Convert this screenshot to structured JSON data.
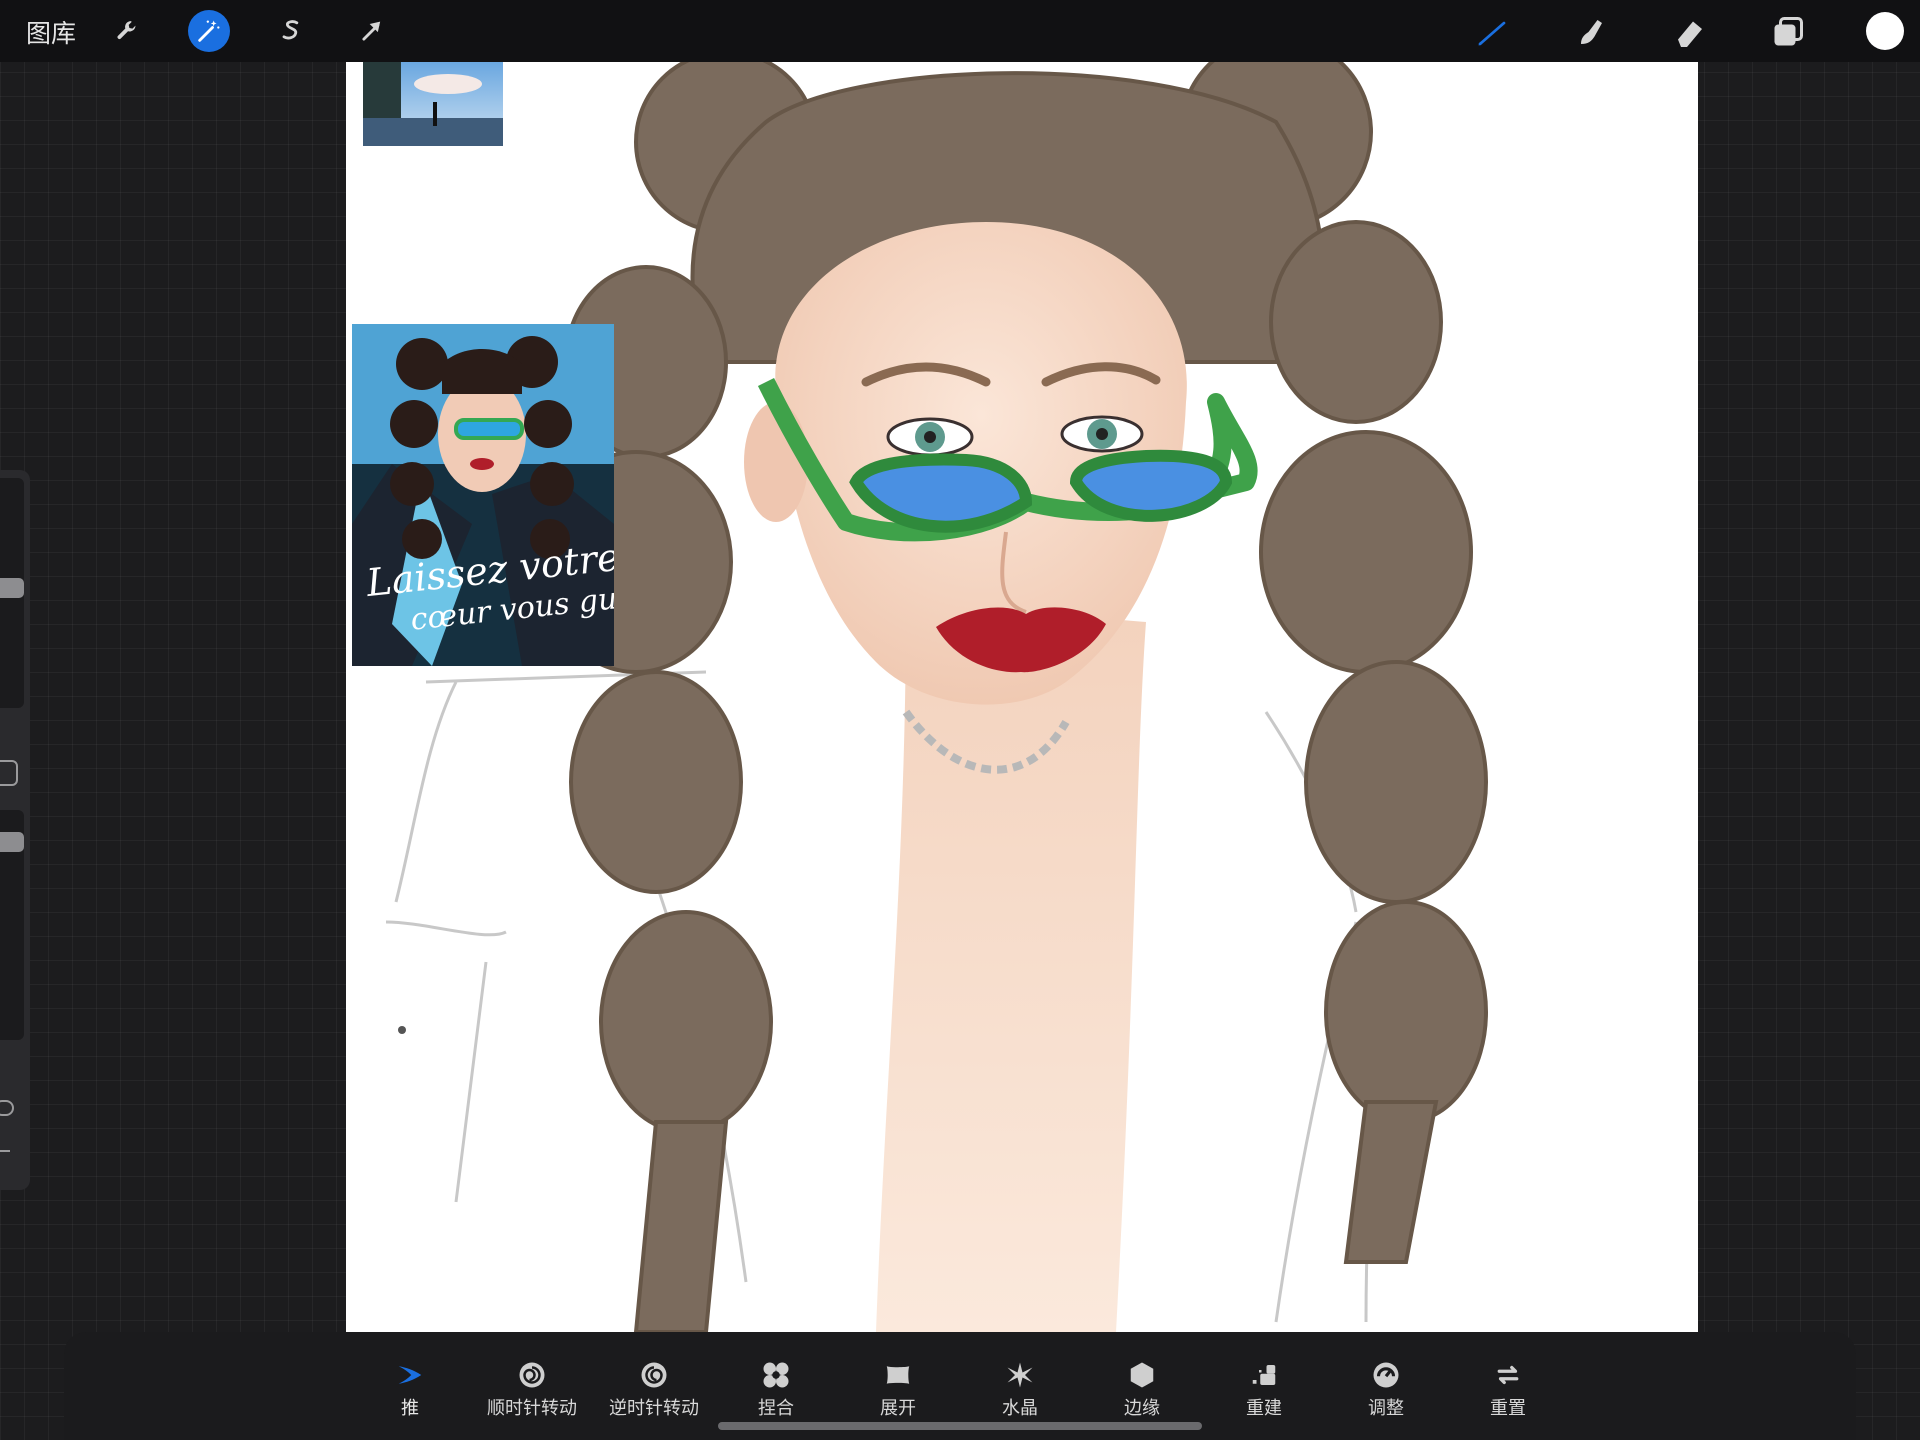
{
  "topbar": {
    "gallery_label": "图库",
    "left_tools": [
      {
        "icon": "wrench-icon"
      },
      {
        "icon": "magic-wand-icon",
        "active": true
      },
      {
        "icon": "selection-s-icon"
      },
      {
        "icon": "transform-arrow-icon"
      }
    ],
    "right_tools": [
      {
        "icon": "brush-icon",
        "active": true
      },
      {
        "icon": "smudge-icon"
      },
      {
        "icon": "eraser-icon"
      },
      {
        "icon": "layers-icon"
      }
    ],
    "current_color": "#ffffff",
    "accent_color": "#1a6fe0"
  },
  "reference_images": [
    {
      "description_icon": "photo-thumbnail"
    },
    {
      "caption_line1": "Laissez votre",
      "caption_line2": "cœur vous guider"
    }
  ],
  "liquify_tools": [
    {
      "label": "推",
      "icon": "push-icon",
      "active": true
    },
    {
      "label": "顺时针转动",
      "icon": "twirl-right-icon"
    },
    {
      "label": "逆时针转动",
      "icon": "twirl-left-icon"
    },
    {
      "label": "捏合",
      "icon": "pinch-icon"
    },
    {
      "label": "展开",
      "icon": "expand-icon"
    },
    {
      "label": "水晶",
      "icon": "crystals-icon"
    },
    {
      "label": "边缘",
      "icon": "edge-icon"
    },
    {
      "label": "重建",
      "icon": "reconstruct-icon"
    },
    {
      "label": "调整",
      "icon": "adjust-icon"
    },
    {
      "label": "重置",
      "icon": "reset-icon"
    }
  ]
}
